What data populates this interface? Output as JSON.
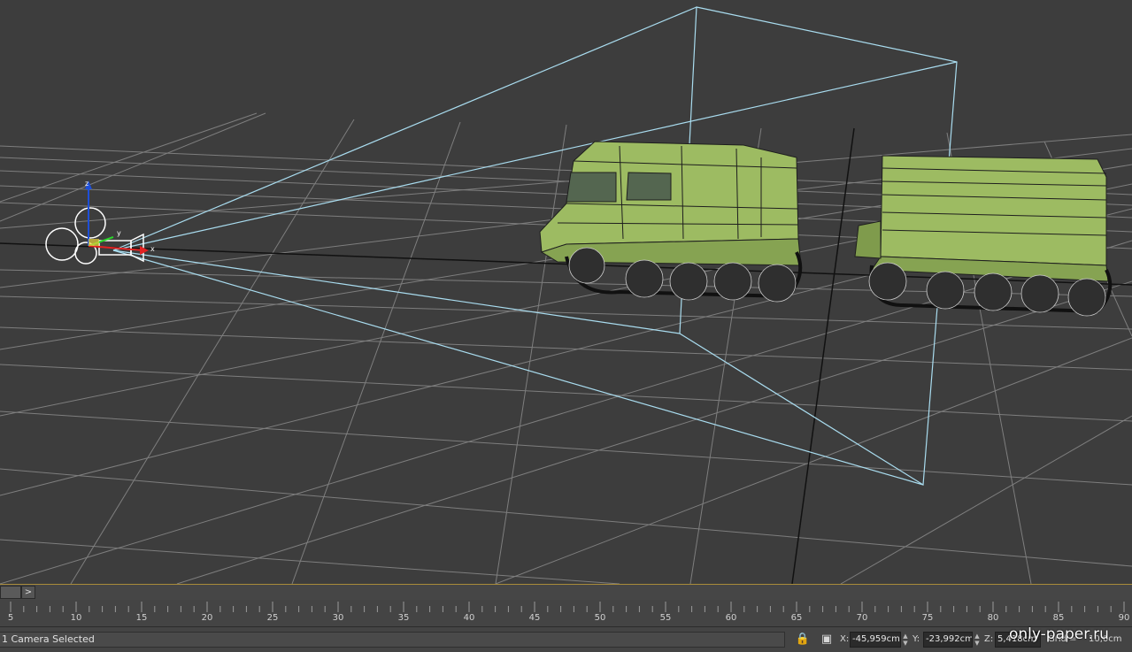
{
  "viewport": {
    "gizmo_axes": {
      "z": "z",
      "y": "y",
      "x": "x"
    }
  },
  "timeline": {
    "next_button": ">",
    "frames": [
      "5",
      "10",
      "15",
      "20",
      "25",
      "30",
      "35",
      "40",
      "45",
      "50",
      "55",
      "60",
      "65",
      "70",
      "75",
      "80",
      "85",
      "90"
    ]
  },
  "status": {
    "selection_text": "1 Camera Selected",
    "lock_icon": "lock-icon",
    "transform_icon": "absolute-mode-icon",
    "x_label": "X:",
    "x_value": "-45,959cm",
    "y_label": "Y:",
    "y_value": "-23,992cm",
    "z_label": "Z:",
    "z_value": "5,418cm",
    "grid_label": "Grid =",
    "grid_value": "10,0cm"
  },
  "watermark": "only-paper.ru",
  "colors": {
    "viewport_bg": "#3d3d3d",
    "grid": "#8a8a8a",
    "camera_frustum": "#a9dcef",
    "model_fill": "#9dbb62",
    "model_dark": "#7f9b4c"
  }
}
